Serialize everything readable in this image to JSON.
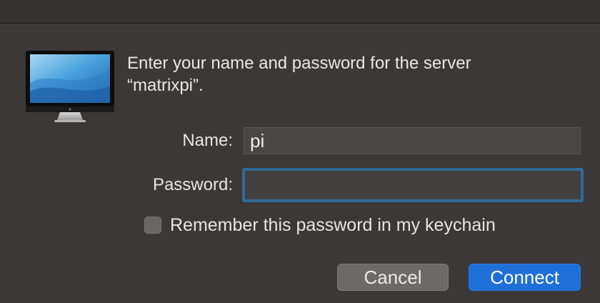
{
  "dialog": {
    "icon": "computer-display-icon",
    "message_line1": "Enter your name and password for the server",
    "message_line2": "“matrixpi”.",
    "name_label": "Name:",
    "name_value": "pi",
    "password_label": "Password:",
    "password_value": "",
    "remember_label": "Remember this password in my keychain",
    "remember_checked": false,
    "cancel_label": "Cancel",
    "connect_label": "Connect"
  },
  "colors": {
    "background": "#3b3837",
    "focus_ring": "#2f6b96",
    "primary_button": "#1f6fd9"
  }
}
